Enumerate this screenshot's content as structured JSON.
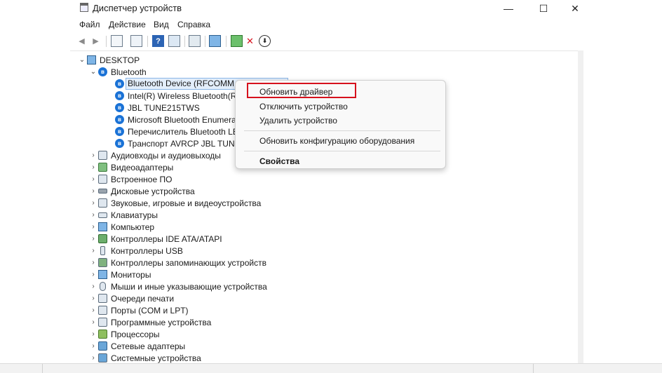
{
  "window": {
    "title": "Диспетчер устройств",
    "minimize": "—",
    "maximize": "☐",
    "close": "✕"
  },
  "menu": [
    "Файл",
    "Действие",
    "Вид",
    "Справка"
  ],
  "toolbar": {
    "buttons": [
      {
        "name": "back-arrow-icon",
        "glyph": "◀"
      },
      {
        "name": "forward-arrow-icon",
        "glyph": "▶"
      },
      {
        "name": "properties-icon",
        "glyph": ""
      },
      {
        "name": "device-view-icon",
        "glyph": ""
      },
      {
        "name": "help-icon",
        "glyph": "?"
      },
      {
        "name": "update-driver-icon",
        "glyph": ""
      },
      {
        "name": "scan-hardware-icon",
        "glyph": ""
      },
      {
        "name": "monitor-icon",
        "glyph": ""
      },
      {
        "name": "add-driver-icon",
        "glyph": ""
      },
      {
        "name": "remove-icon",
        "glyph": "✕"
      },
      {
        "name": "download-icon",
        "glyph": "⬇"
      }
    ]
  },
  "tree": {
    "root": "DESKTOP",
    "bluetooth": {
      "label": "Bluetooth",
      "children": [
        "Bluetooth Device (RFCOMM Protocol TDI)",
        "Intel(R) Wireless Bluetooth(R)",
        "JBL TUNE215TWS",
        "Microsoft Bluetooth Enumerator",
        "Перечислитель Bluetooth LE",
        "Транспорт AVRCP JBL TUNE215TWS"
      ]
    },
    "categories": [
      "Аудиовходы и аудиовыходы",
      "Видеоадаптеры",
      "Встроенное ПО",
      "Дисковые устройства",
      "Звуковые, игровые и видеоустройства",
      "Клавиатуры",
      "Компьютер",
      "Контроллеры IDE ATA/ATAPI",
      "Контроллеры USB",
      "Контроллеры запоминающих устройств",
      "Мониторы",
      "Мыши и иные указывающие устройства",
      "Очереди печати",
      "Порты (COM и LPT)",
      "Программные устройства",
      "Процессоры",
      "Сетевые адаптеры",
      "Системные устройства"
    ]
  },
  "context_menu": {
    "update_driver": "Обновить драйвер",
    "disable_device": "Отключить устройство",
    "uninstall_device": "Удалить устройство",
    "scan_hardware": "Обновить конфигурацию оборудования",
    "properties": "Свойства"
  },
  "colors": {
    "bluetooth": "#1a72d6",
    "highlight": "#d6111d",
    "selection": "#e3eefb"
  }
}
